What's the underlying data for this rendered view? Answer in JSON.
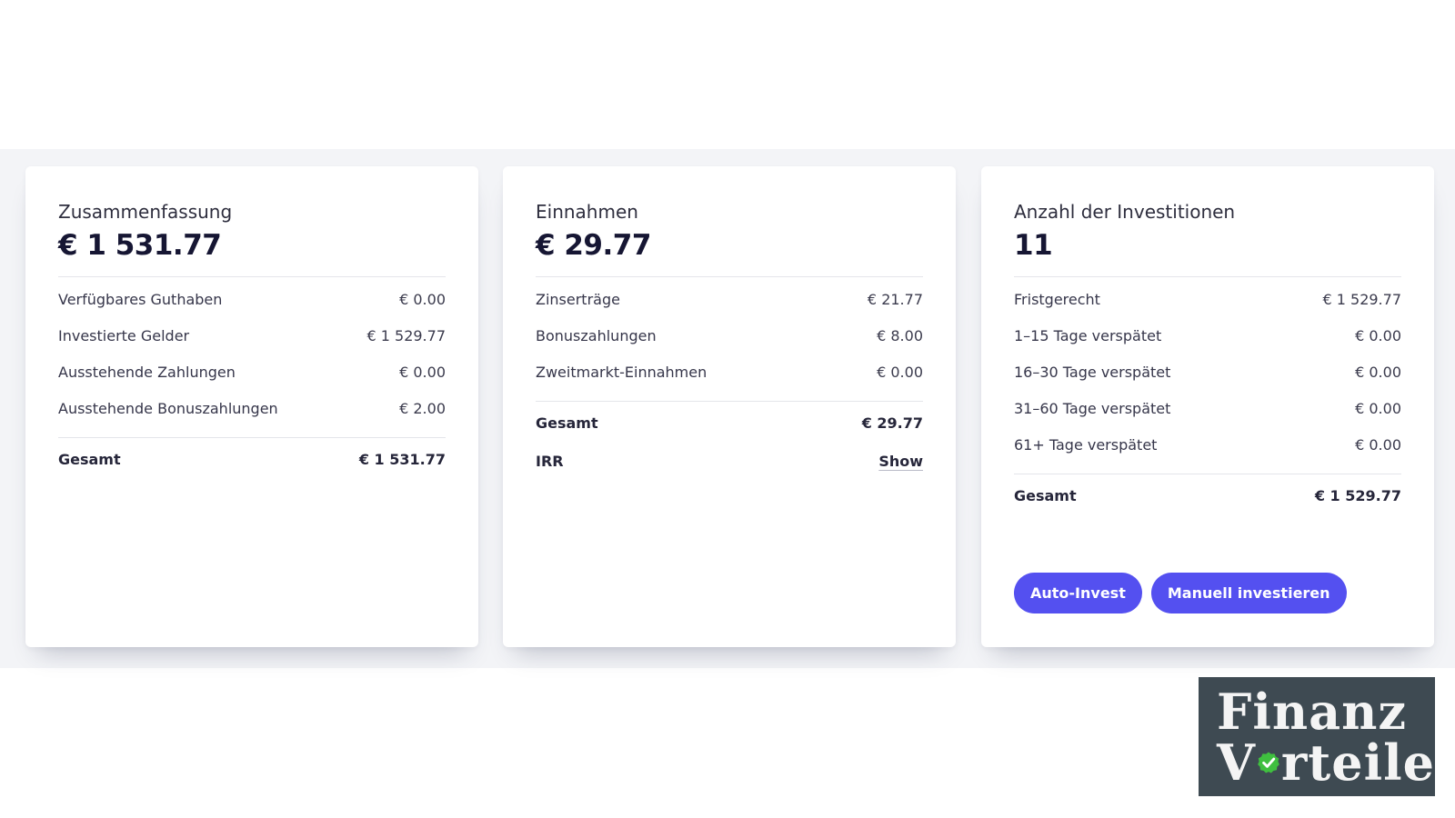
{
  "summary": {
    "label": "Zusammenfassung",
    "amount": "€ 1 531.77",
    "rows": [
      {
        "label": "Verfügbares Guthaben",
        "value": "€ 0.00"
      },
      {
        "label": "Investierte Gelder",
        "value": "€ 1 529.77"
      },
      {
        "label": "Ausstehende Zahlungen",
        "value": "€ 0.00"
      },
      {
        "label": "Ausstehende Bonuszahlungen",
        "value": "€ 2.00"
      }
    ],
    "total_label": "Gesamt",
    "total_value": "€ 1 531.77"
  },
  "income": {
    "label": "Einnahmen",
    "amount": "€ 29.77",
    "rows": [
      {
        "label": "Zinserträge",
        "value": "€ 21.77"
      },
      {
        "label": "Bonuszahlungen",
        "value": "€ 8.00"
      },
      {
        "label": "Zweitmarkt-Einnahmen",
        "value": "€ 0.00"
      }
    ],
    "total_label": "Gesamt",
    "total_value": "€ 29.77",
    "irr_label": "IRR",
    "irr_link": "Show"
  },
  "investments": {
    "label": "Anzahl der Investitionen",
    "count": "11",
    "rows": [
      {
        "label": "Fristgerecht",
        "value": "€ 1 529.77"
      },
      {
        "label": "1–15 Tage verspätet",
        "value": "€ 0.00"
      },
      {
        "label": "16–30 Tage verspätet",
        "value": "€ 0.00"
      },
      {
        "label": "31–60 Tage verspätet",
        "value": "€ 0.00"
      },
      {
        "label": "61+ Tage verspätet",
        "value": "€ 0.00"
      }
    ],
    "total_label": "Gesamt",
    "total_value": "€ 1 529.77",
    "auto_invest_label": "Auto-Invest",
    "manual_invest_label": "Manuell investieren"
  },
  "watermark": {
    "line1": "Finanz",
    "line2_start": "V",
    "line2_end": "rteile",
    "icon": "check-icon"
  },
  "colors": {
    "accent": "#5450f0",
    "band": "#f3f4f7",
    "logo_bg": "#3e4a52",
    "check": "#3fbf3f"
  }
}
